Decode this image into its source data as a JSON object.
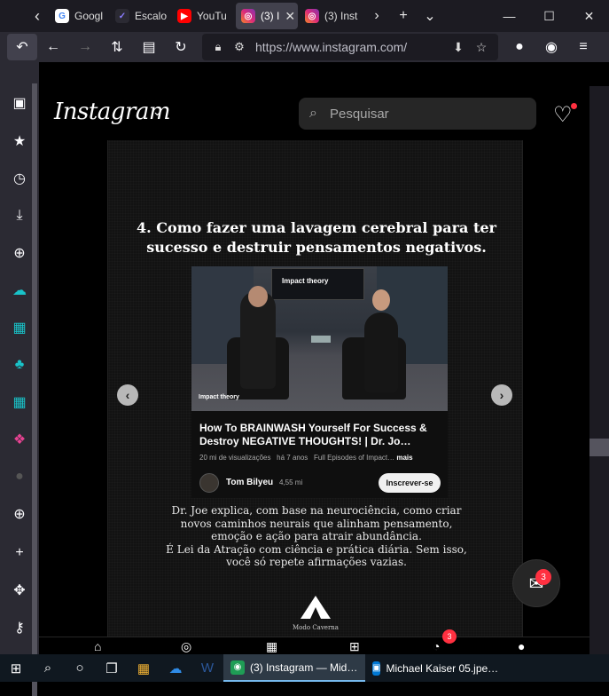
{
  "browser": {
    "tabs": [
      {
        "title": "Googl",
        "favicon": "google-icon"
      },
      {
        "title": "Escalo",
        "favicon": "escalo-icon"
      },
      {
        "title": "YouTu",
        "favicon": "youtube-icon"
      },
      {
        "title": "(3) I",
        "favicon": "instagram-icon",
        "active": true
      },
      {
        "title": "(3) Inst",
        "favicon": "instagram-icon"
      }
    ],
    "url": "https://www.instagram.com/"
  },
  "instagram": {
    "logo": "Instagram",
    "search_placeholder": "Pesquisar",
    "post": {
      "heading": "4. Como fazer uma lavagem cerebral para ter sucesso e destruir pensamentos negativos.",
      "video": {
        "thumb_brand": "Impact theory",
        "thumb_watermark": "Impact theory",
        "title": "How To BRAINWASH Yourself For Success & Destroy NEGATIVE THOUGHTS! | Dr. Jo…",
        "views": "20 mi de visualizações",
        "age": "há 7 anos",
        "desc": "Full Episodes of Impact…",
        "more": "mais",
        "channel": "Tom Bilyeu",
        "subscribers": "4,55 mi",
        "subscribe_label": "Inscrever-se"
      },
      "caption_lines": [
        "Dr. Joe explica, com base na neurociência, como criar",
        "novos caminhos neurais que alinham pensamento,",
        "emoção e ação para atrair abundância.",
        "É Lei da Atração com ciência e prática diária. Sem isso,",
        "você só repete afirmações vazias."
      ],
      "brand_name": "Modo Caverna"
    },
    "messages_badge": "3",
    "bottom_badge": "3"
  },
  "taskbar": {
    "apps": [
      {
        "label": "(3) Instagram — Mid…",
        "icon": "firefox-icon",
        "active": true
      },
      {
        "label": "Michael Kaiser 05.jpe…",
        "icon": "photos-icon",
        "active": false
      }
    ]
  },
  "colors": {
    "browser_chrome": "#2b2a33",
    "tab_strip": "#1c1b22",
    "notification_red": "#ff3040",
    "page_background": "#000000"
  }
}
